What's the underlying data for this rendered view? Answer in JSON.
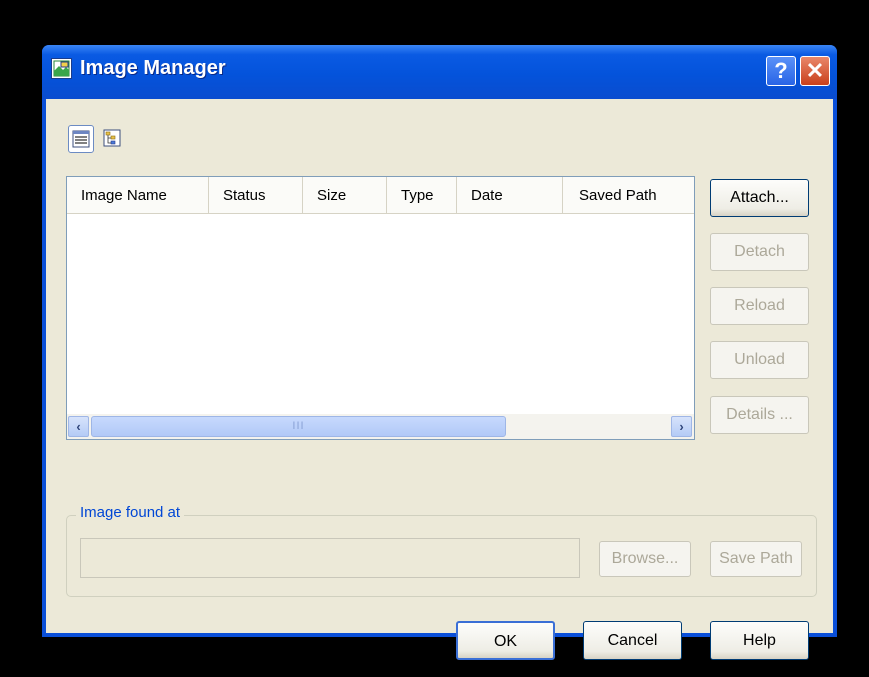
{
  "window": {
    "title": "Image Manager",
    "help_label": "?",
    "close_label": "✕"
  },
  "toolbar": {
    "list_view_icon": "list-view-icon",
    "tree_view_icon": "tree-view-icon"
  },
  "list": {
    "columns": [
      "Image Name",
      "Status",
      "Size",
      "Type",
      "Date",
      "Saved Path"
    ],
    "rows": [],
    "scroll_left": "‹",
    "scroll_right": "›",
    "scroll_grip": "III"
  },
  "side_buttons": {
    "attach": "Attach...",
    "detach": "Detach",
    "reload": "Reload",
    "unload": "Unload",
    "details": "Details ..."
  },
  "image_found_at": {
    "label": "Image found at",
    "value": "",
    "browse": "Browse...",
    "save_path": "Save Path"
  },
  "footer": {
    "ok": "OK",
    "cancel": "Cancel",
    "help": "Help"
  },
  "colors": {
    "titlebar": "#0453db",
    "dialog_bg": "#ece9d8",
    "group_label": "#0046d5",
    "disabled_text": "#aca899"
  }
}
